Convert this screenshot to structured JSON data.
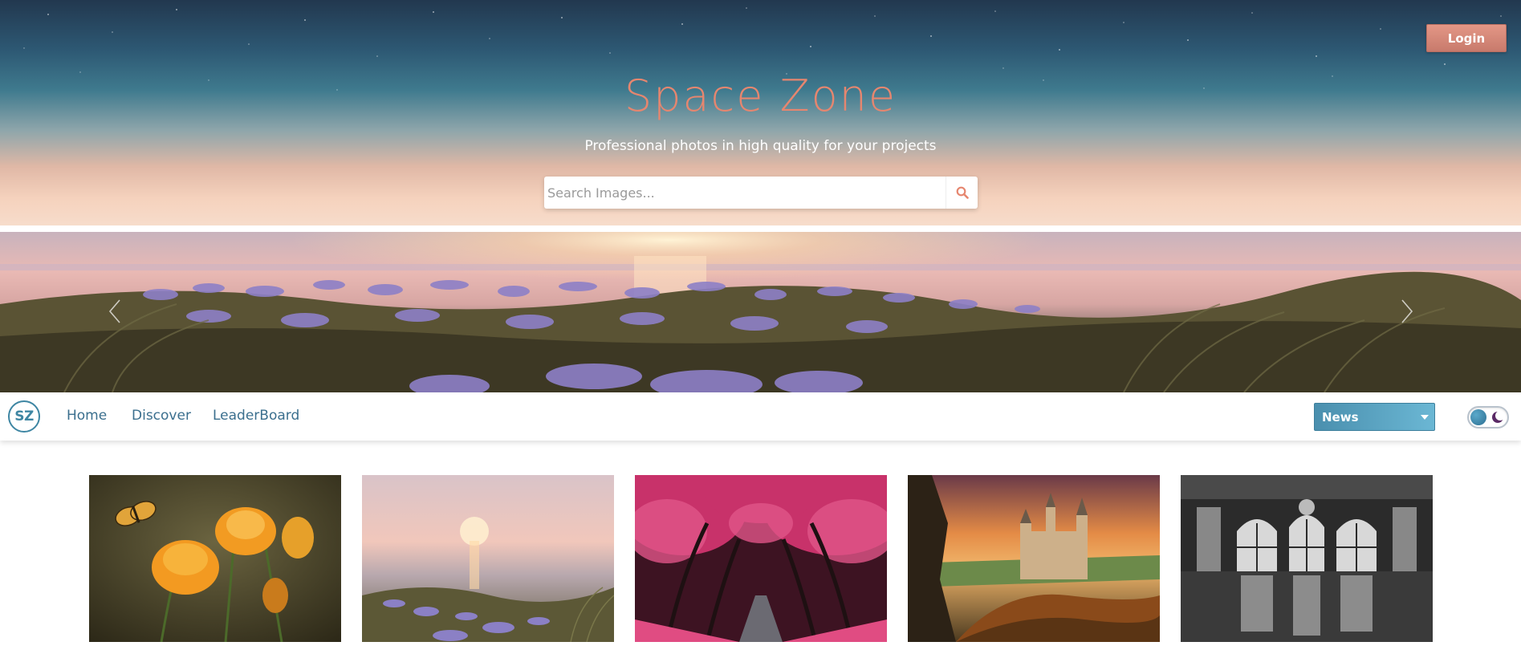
{
  "header": {
    "login_label": "Login",
    "title": "Space Zone",
    "subtitle": "Professional photos in high quality for your projects"
  },
  "search": {
    "placeholder": "Search Images...",
    "value": "",
    "icon": "search-icon"
  },
  "carousel": {
    "prev_icon": "chevron-left-icon",
    "next_icon": "chevron-right-icon",
    "current_image": "sunset-flower-field"
  },
  "navbar": {
    "logo_text": "SZ",
    "links": [
      {
        "label": "Home"
      },
      {
        "label": "Discover"
      },
      {
        "label": "LeaderBoard"
      }
    ],
    "category_select": {
      "selected": "News"
    },
    "theme_toggle": {
      "icon": "moon-icon",
      "mode": "light"
    }
  },
  "gallery": {
    "images": [
      {
        "subject": "orange-flowers-butterfly"
      },
      {
        "subject": "sunset-sea-flowers"
      },
      {
        "subject": "pink-cherry-tree-avenue"
      },
      {
        "subject": "castle-at-sunset"
      },
      {
        "subject": "black-white-ballroom"
      }
    ]
  },
  "colors": {
    "accent_salmon": "#e6866f",
    "accent_blue": "#3b6f8e",
    "select_blue": "#5aa3c2",
    "white": "#ffffff"
  }
}
